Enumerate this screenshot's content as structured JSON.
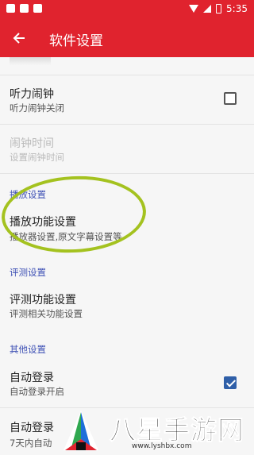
{
  "status_bar": {
    "time": "5:35"
  },
  "app_bar": {
    "back_icon": "arrow-left-icon",
    "title": "软件设置"
  },
  "prefs": {
    "listen_alarm": {
      "title": "听力闹钟",
      "summary": "听力闹钟关闭",
      "checked": false
    },
    "alarm_time": {
      "title": "闹钟时间",
      "summary": "设置闹钟时间"
    },
    "play_category": "播放设置",
    "play_function": {
      "title": "播放功能设置",
      "summary": "播放器设置,原文字幕设置等"
    },
    "eval_category": "评测设置",
    "eval_function": {
      "title": "评测功能设置",
      "summary": "评测相关功能设置"
    },
    "other_category": "其他设置",
    "auto_login": {
      "title": "自动登录",
      "summary": "自动登录开启",
      "checked": true
    },
    "auto_login_7days": {
      "title": "自动登录",
      "summary": "7天内自动"
    }
  },
  "watermark": {
    "text": "八星手游网",
    "url": "www.lyshbx.com"
  },
  "colors": {
    "accent": "#e0232e",
    "category": "#3f51b5",
    "checkbox": "#2f5fa8"
  }
}
